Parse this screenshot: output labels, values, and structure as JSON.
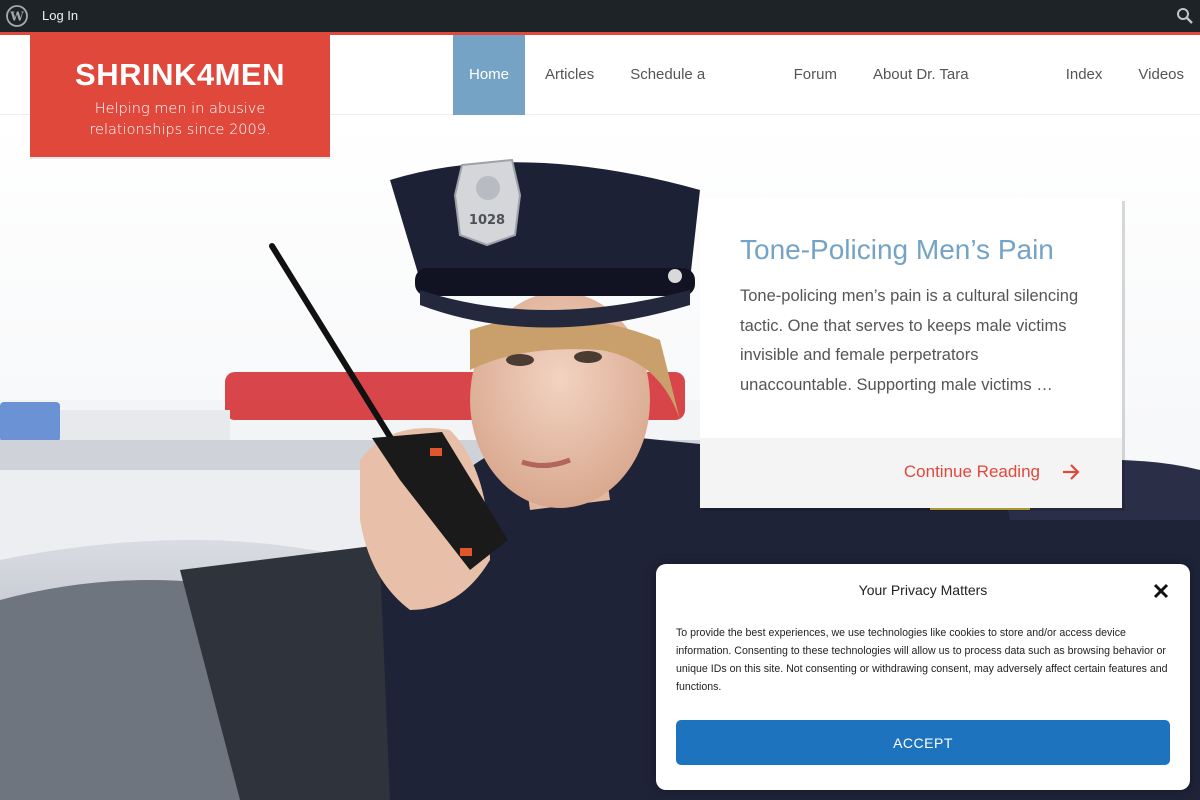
{
  "adminbar": {
    "login_label": "Log In",
    "logo_icon": "wordpress-logo-icon",
    "search_icon": "search-icon"
  },
  "site": {
    "title": "SHRINK4MEN",
    "tagline": "Helping men in abusive relationships since 2009."
  },
  "nav": {
    "items": [
      {
        "label": "Home",
        "active": true
      },
      {
        "label": "Articles"
      },
      {
        "label": "Schedule a Session"
      },
      {
        "label": "Forum"
      },
      {
        "label": "About Dr. Tara Palmatier"
      },
      {
        "label": "Index"
      },
      {
        "label": "Videos"
      }
    ]
  },
  "featured": {
    "title": "Tone-Policing Men’s Pain",
    "excerpt": " Tone-policing men’s pain is a cultural silencing tactic. One that serves to keeps male victims invisible and female perpetrators unaccountable. Supporting male victims …",
    "continue_label": "Continue Reading",
    "badge_number": "1028"
  },
  "privacy": {
    "title": "Your Privacy Matters",
    "text": "To provide the best experiences, we use technologies like cookies to store and/or access device information. Consenting to these technologies will allow us to process data such as browsing behavior or unique IDs on this site. Not consenting or withdrawing consent, may adversely affect certain features and functions.",
    "accept_label": "ACCEPT"
  },
  "colors": {
    "brand_red": "#e0483c",
    "accent_blue": "#74a3c6",
    "button_blue": "#1e73be",
    "adminbar": "#1d2327"
  }
}
